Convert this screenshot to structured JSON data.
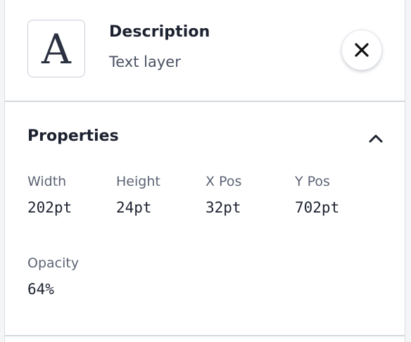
{
  "layer": {
    "thumbnail_glyph": "A",
    "title": "Description",
    "subtitle": "Text layer"
  },
  "close": {
    "icon": "close-icon"
  },
  "properties": {
    "heading": "Properties",
    "collapse_icon": "chevron-up-icon",
    "items": [
      {
        "label": "Width",
        "value": "202pt"
      },
      {
        "label": "Height",
        "value": "24pt"
      },
      {
        "label": "X Pos",
        "value": "32pt"
      },
      {
        "label": "Y Pos",
        "value": "702pt"
      },
      {
        "label": "Opacity",
        "value": "64%"
      }
    ]
  },
  "colors": {
    "text_primary": "#1d2230",
    "text_secondary": "#5d6475",
    "border": "#d4d8e0",
    "background": "#ffffff"
  }
}
